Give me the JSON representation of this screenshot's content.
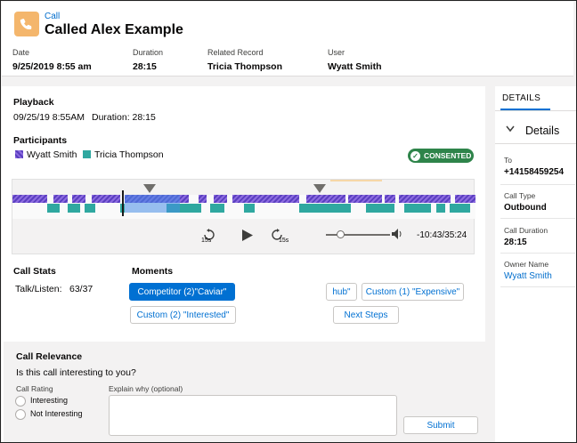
{
  "header": {
    "object_type": "Call",
    "title": "Called Alex Example",
    "fields": [
      {
        "label": "Date",
        "value": "9/25/2019 8:55 am"
      },
      {
        "label": "Duration",
        "value": "28:15"
      },
      {
        "label": "Related Record",
        "value": "Tricia Thompson"
      },
      {
        "label": "User",
        "value": "Wyatt Smith"
      }
    ]
  },
  "playback": {
    "title": "Playback",
    "date": "09/25/19 8:55AM",
    "duration_text": "Duration: 28:15",
    "participants_title": "Participants",
    "participants": [
      {
        "name": "Wyatt Smith",
        "color": "#7b57d6"
      },
      {
        "name": "Tricia Thompson",
        "color": "#2fa8a0"
      }
    ],
    "consent_badge": "CONSENTED",
    "skip_back_label": "15s",
    "skip_forward_label": "15s",
    "time_display": "-10:43/35:24",
    "progress": 0.3,
    "volume": 0.25
  },
  "call_stats": {
    "title": "Call Stats",
    "label": "Talk/Listen:",
    "value": "63/37"
  },
  "moments": {
    "title": "Moments",
    "buttons": [
      "Competitor (2)\"Caviar\"",
      "Custom (2)  \"Interested\"",
      "hub\"",
      "Custom (1)  \"Expensive\"",
      "Next Steps"
    ]
  },
  "relevance": {
    "title": "Call Relevance",
    "question": "Is this call interesting to you?",
    "rating_label": "Call Rating",
    "options": [
      "Interesting",
      "Not Interesting"
    ],
    "explain_label": "Explain why (optional)",
    "submit_label": "Submit"
  },
  "details": {
    "tab_label": "DETAILS",
    "section_label": "Details",
    "fields": [
      {
        "label": "To",
        "value": "+14158459254"
      },
      {
        "label": "Call Type",
        "value": "Outbound"
      },
      {
        "label": "Call Duration",
        "value": "28:15"
      },
      {
        "label": "Owner Name",
        "value": "Wyatt Smith"
      }
    ]
  }
}
